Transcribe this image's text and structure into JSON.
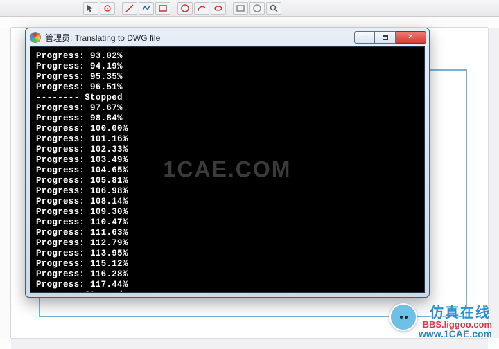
{
  "window": {
    "title": "管理员: Translating to DWG file"
  },
  "console": {
    "lines": [
      "Progress: 93.02%",
      "Progress: 94.19%",
      "Progress: 95.35%",
      "Progress: 96.51%",
      "-------- Stopped",
      "Progress: 97.67%",
      "Progress: 98.84%",
      "Progress: 100.00%",
      "Progress: 101.16%",
      "Progress: 102.33%",
      "Progress: 103.49%",
      "Progress: 104.65%",
      "Progress: 105.81%",
      "Progress: 106.98%",
      "Progress: 108.14%",
      "Progress: 109.30%",
      "Progress: 110.47%",
      "Progress: 111.63%",
      "Progress: 112.79%",
      "Progress: 113.95%",
      "Progress: 115.12%",
      "Progress: 116.28%",
      "Progress: 117.44%",
      "-------- Stopped"
    ]
  },
  "watermark": {
    "center": "1CAE.COM",
    "label_cn": "仿真在线",
    "bbs": "BBS.liggoo.com",
    "url": "www.1CAE.com"
  },
  "toolbar_icons": [
    "arrow-icon",
    "select-icon",
    "line-icon",
    "polyline-icon",
    "rect-icon",
    "circle-icon",
    "arc-icon",
    "ellipse-icon",
    "rect2-icon",
    "circle2-icon",
    "search-icon"
  ]
}
